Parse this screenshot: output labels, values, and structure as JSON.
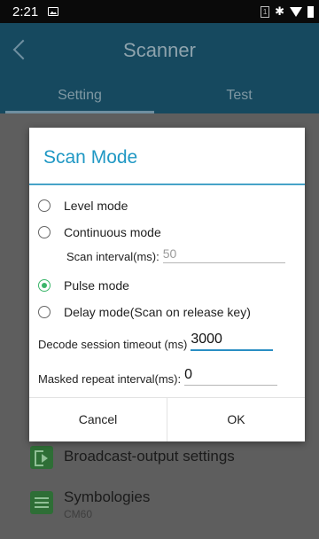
{
  "status_bar": {
    "time": "2:21",
    "sim_label": "1",
    "bluetooth_glyph": "✱"
  },
  "app_bar": {
    "title": "Scanner",
    "tabs": [
      {
        "label": "Setting",
        "active": true
      },
      {
        "label": "Test",
        "active": false
      }
    ]
  },
  "background_list": [
    {
      "label": "Broadcast-output settings",
      "icon": "broadcast-icon"
    },
    {
      "label": "Symbologies",
      "subtitle": "CM60",
      "icon": "symbologies-icon"
    }
  ],
  "dialog": {
    "title": "Scan Mode",
    "options": [
      {
        "label": "Level mode",
        "checked": false
      },
      {
        "label": "Continuous mode",
        "checked": false
      },
      {
        "label": "Pulse mode",
        "checked": true
      },
      {
        "label": "Delay mode(Scan on release key)",
        "checked": false
      }
    ],
    "scan_interval": {
      "label": "Scan interval(ms):",
      "value": "50"
    },
    "decode_timeout": {
      "label": "Decode session timeout (ms)",
      "value": "3000"
    },
    "masked_repeat": {
      "label": "Masked repeat interval(ms):",
      "value": "0"
    },
    "cancel_label": "Cancel",
    "ok_label": "OK"
  },
  "colors": {
    "accent": "#2098c4",
    "radio_checked": "#3bb56a",
    "app_bar_dimmed": "#16495f"
  }
}
